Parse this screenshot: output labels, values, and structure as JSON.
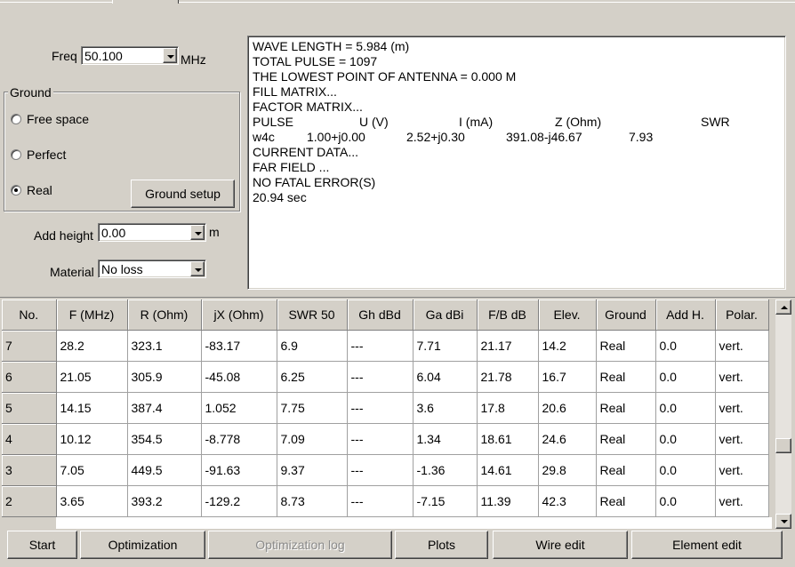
{
  "freq": {
    "label": "Freq",
    "value": "50.100",
    "unit": "MHz"
  },
  "ground": {
    "title": "Ground",
    "options": [
      {
        "label": "Free space",
        "selected": false
      },
      {
        "label": "Perfect",
        "selected": false
      },
      {
        "label": "Real",
        "selected": true
      }
    ],
    "setup_label": "Ground setup"
  },
  "add_height": {
    "label": "Add height",
    "value": "0.00",
    "unit": "m"
  },
  "material": {
    "label": "Material",
    "value": "No loss"
  },
  "log": {
    "lines": [
      "WAVE LENGTH = 5.984 (m)",
      "TOTAL PULSE = 1097",
      "THE LOWEST POINT OF ANTENNA = 0.000 M",
      "FILL MATRIX...",
      "FACTOR MATRIX...",
      "PULSE",
      "w4c",
      "CURRENT DATA...",
      "FAR FIELD ...",
      "NO FATAL ERROR(S)",
      "20.94 sec"
    ],
    "pulse_cols": [
      "U (V)",
      "I (mA)",
      "Z (Ohm)",
      "SWR"
    ],
    "pulse_vals": [
      "1.00+j0.00",
      "2.52+j0.30",
      "391.08-j46.67",
      "7.93"
    ]
  },
  "table": {
    "headers": [
      "No.",
      "F (MHz)",
      "R (Ohm)",
      "jX (Ohm)",
      "SWR 50",
      "Gh dBd",
      "Ga dBi",
      "F/B dB",
      "Elev.",
      "Ground",
      "Add H.",
      "Polar."
    ],
    "rows": [
      [
        "7",
        "28.2",
        "323.1",
        "-83.17",
        "6.9",
        "---",
        "7.71",
        "21.17",
        "14.2",
        "Real",
        "0.0",
        "vert."
      ],
      [
        "6",
        "21.05",
        "305.9",
        "-45.08",
        "6.25",
        "---",
        "6.04",
        "21.78",
        "16.7",
        "Real",
        "0.0",
        "vert."
      ],
      [
        "5",
        "14.15",
        "387.4",
        "1.052",
        "7.75",
        "---",
        "3.6",
        "17.8",
        "20.6",
        "Real",
        "0.0",
        "vert."
      ],
      [
        "4",
        "10.12",
        "354.5",
        "-8.778",
        "7.09",
        "---",
        "1.34",
        "18.61",
        "24.6",
        "Real",
        "0.0",
        "vert."
      ],
      [
        "3",
        "7.05",
        "449.5",
        "-91.63",
        "9.37",
        "---",
        "-1.36",
        "14.61",
        "29.8",
        "Real",
        "0.0",
        "vert."
      ],
      [
        "2",
        "3.65",
        "393.2",
        "-129.2",
        "8.73",
        "---",
        "-7.15",
        "11.39",
        "42.3",
        "Real",
        "0.0",
        "vert."
      ]
    ]
  },
  "buttons": {
    "start": "Start",
    "optimization": "Optimization",
    "optimization_log": "Optimization log",
    "plots": "Plots",
    "wire_edit": "Wire edit",
    "element_edit": "Element edit"
  }
}
